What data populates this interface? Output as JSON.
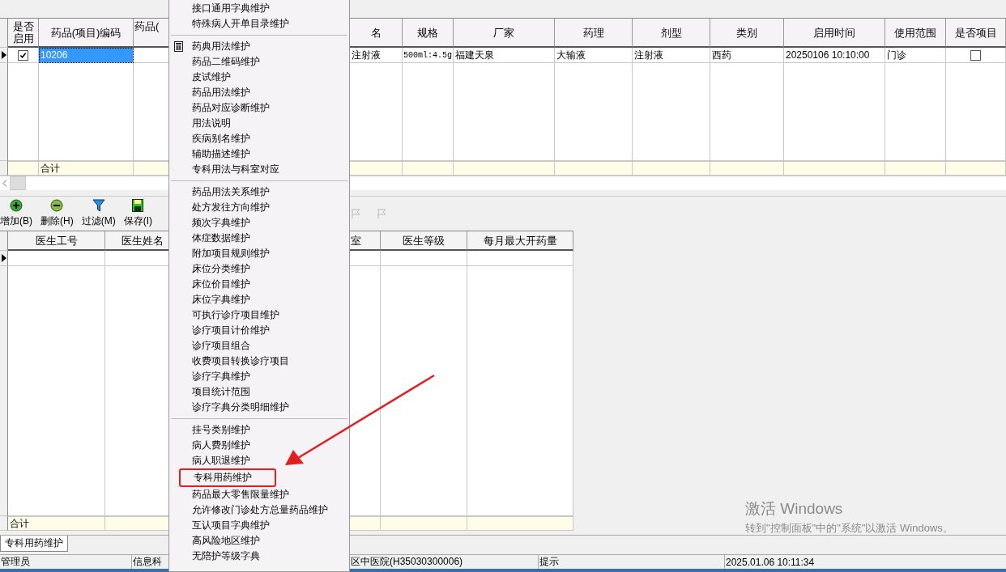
{
  "top_table": {
    "columns": [
      {
        "label": "是否启用",
        "kind": "check"
      },
      {
        "label": "药品(项目)编码",
        "kind": "text"
      },
      {
        "label": "药品(",
        "kind": "text"
      },
      {
        "label": "名",
        "kind": "text"
      },
      {
        "label": "规格",
        "kind": "text"
      },
      {
        "label": "厂家",
        "kind": "text"
      },
      {
        "label": "药理",
        "kind": "text"
      },
      {
        "label": "剂型",
        "kind": "text"
      },
      {
        "label": "类别",
        "kind": "text"
      },
      {
        "label": "启用时间",
        "kind": "text"
      },
      {
        "label": "使用范围",
        "kind": "text"
      },
      {
        "label": "是否项目",
        "kind": "check"
      }
    ],
    "rows": [
      {
        "current": true,
        "cells": [
          {
            "checked": true
          },
          {
            "text": "10206",
            "selected": true
          },
          {
            "selected": false
          },
          {
            "text": "注射液",
            "selected": false
          },
          {
            "text": "500ml:4.5g",
            "selected": false
          },
          {
            "text": "福建天泉",
            "selected": false
          },
          {
            "text": "大输液",
            "selected": false
          },
          {
            "text": "注射液",
            "selected": false
          },
          {
            "text": "西药",
            "selected": false
          },
          {
            "text": "20250106 10:10:00",
            "selected": false
          },
          {
            "text": "门诊",
            "selected": false
          },
          {
            "checked": false
          }
        ]
      }
    ],
    "total_label": "合计"
  },
  "toolbar": [
    {
      "kind": "add",
      "label": "增加(B)",
      "disabled": false
    },
    {
      "kind": "delete",
      "label": "删除(H)",
      "disabled": false
    },
    {
      "kind": "filter",
      "label": "过滤(M)",
      "disabled": false
    },
    {
      "kind": "save",
      "label": "保存(I)",
      "disabled": false
    },
    {
      "kind": "flag",
      "disabled": true
    },
    {
      "kind": "flag",
      "disabled": true
    }
  ],
  "bottom_table": {
    "columns": [
      {
        "label": "医生工号"
      },
      {
        "label": "医生姓名"
      },
      {
        "label": "室"
      },
      {
        "label": "医生等级"
      },
      {
        "label": "每月最大开药量"
      }
    ],
    "rows": [
      {
        "current": true
      }
    ],
    "total_label": "合计"
  },
  "tabs": [
    {
      "label": "专科用药维护",
      "selected": true
    }
  ],
  "status_bar": [
    "管理员",
    "信息科",
    "区中医院(H35030300006)",
    "提示",
    "2025.01.06  10:11:34"
  ],
  "menu": {
    "groups": [
      [
        {
          "label": "接口通用字典维护",
          "kind": "plain",
          "annotated": false
        },
        {
          "label": "特殊病人开单目录维护",
          "kind": "plain",
          "annotated": false
        }
      ],
      [
        {
          "label": "药典用法维护",
          "kind": "icon",
          "annotated": false
        },
        {
          "label": "药品二维码维护",
          "kind": "plain",
          "annotated": false
        },
        {
          "label": "皮试维护",
          "kind": "plain",
          "annotated": false
        },
        {
          "label": "药品用法维护",
          "kind": "plain",
          "annotated": false
        },
        {
          "label": "药品对应诊断维护",
          "kind": "plain",
          "annotated": false
        },
        {
          "label": "用法说明",
          "kind": "plain",
          "annotated": false
        },
        {
          "label": "疾病别名维护",
          "kind": "plain",
          "annotated": false
        },
        {
          "label": "辅助描述维护",
          "kind": "plain",
          "annotated": false
        },
        {
          "label": "专科用法与科室对应",
          "kind": "plain",
          "annotated": false
        }
      ],
      [
        {
          "label": "药品用法关系维护",
          "kind": "plain",
          "annotated": false
        },
        {
          "label": "处方发往方向维护",
          "kind": "plain",
          "annotated": false
        },
        {
          "label": "频次字典维护",
          "kind": "plain",
          "annotated": false
        },
        {
          "label": "体症数据维护",
          "kind": "plain",
          "annotated": false
        },
        {
          "label": "附加项目规则维护",
          "kind": "plain",
          "annotated": false
        },
        {
          "label": "床位分类维护",
          "kind": "plain",
          "annotated": false
        },
        {
          "label": "床位价目维护",
          "kind": "plain",
          "annotated": false
        },
        {
          "label": "床位字典维护",
          "kind": "plain",
          "annotated": false
        },
        {
          "label": "可执行诊疗项目维护",
          "kind": "plain",
          "annotated": false
        },
        {
          "label": "诊疗项目计价维护",
          "kind": "plain",
          "annotated": false
        },
        {
          "label": "诊疗项目组合",
          "kind": "plain",
          "annotated": false
        },
        {
          "label": "收费项目转换诊疗项目",
          "kind": "plain",
          "annotated": false
        },
        {
          "label": "诊疗字典维护",
          "kind": "plain",
          "annotated": false
        },
        {
          "label": "项目统计范围",
          "kind": "plain",
          "annotated": false
        },
        {
          "label": "诊疗字典分类明细维护",
          "kind": "plain",
          "annotated": false
        }
      ],
      [
        {
          "label": "挂号类别维护",
          "kind": "plain",
          "annotated": false
        },
        {
          "label": "病人费别维护",
          "kind": "plain",
          "annotated": false
        },
        {
          "label": "病人职退维护",
          "kind": "plain",
          "annotated": false
        },
        {
          "label": "专科用药维护",
          "kind": "plain",
          "annotated": true
        },
        {
          "label": "药品最大零售限量维护",
          "kind": "plain",
          "annotated": false
        },
        {
          "label": "允许修改门诊处方总量药品维护",
          "kind": "plain",
          "annotated": false
        },
        {
          "label": "互认项目字典维护",
          "kind": "plain",
          "annotated": false
        },
        {
          "label": "高风险地区维护",
          "kind": "plain",
          "annotated": false
        },
        {
          "label": "无陪护等级字典",
          "kind": "plain",
          "annotated": false
        }
      ]
    ]
  },
  "watermark": {
    "title": "激活 Windows",
    "text": "转到\"控制面板\"中的\"系统\"以激活 Windows。"
  }
}
